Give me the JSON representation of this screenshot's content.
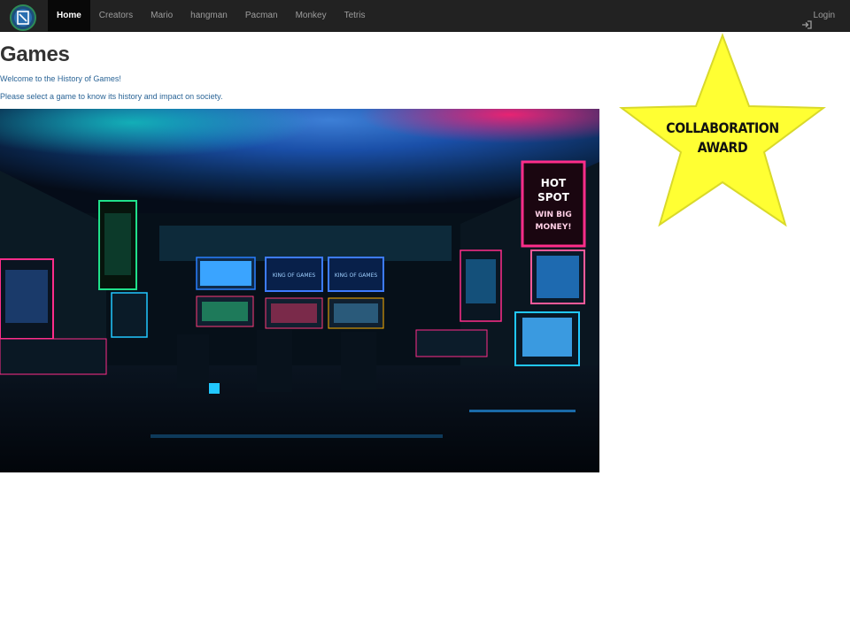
{
  "nav": {
    "items": [
      {
        "label": "Home",
        "active": true
      },
      {
        "label": "Creators",
        "active": false
      },
      {
        "label": "Mario",
        "active": false
      },
      {
        "label": "hangman",
        "active": false
      },
      {
        "label": "Pacman",
        "active": false
      },
      {
        "label": "Monkey",
        "active": false
      },
      {
        "label": "Tetris",
        "active": false
      }
    ],
    "login_label": "Login"
  },
  "main": {
    "title": "Games",
    "welcome": "Welcome to the History of Games!",
    "instruction": "Please select a game to know its history and impact on society."
  },
  "award": {
    "line1": "COLLABORATION",
    "line2": "AWARD",
    "color": "#ffff33"
  },
  "hero": {
    "screen_text_1": "KING OF GAMES",
    "screen_text_2": "KING OF GAMES",
    "marquee_1": "HOT",
    "marquee_2": "SPOT",
    "marquee_3": "WIN BIG",
    "marquee_4": "MONEY!"
  },
  "colors": {
    "navbar": "#222222",
    "accent_link": "#2a6496",
    "neon_pink": "#ff2d8a",
    "neon_cyan": "#21c8ff"
  }
}
